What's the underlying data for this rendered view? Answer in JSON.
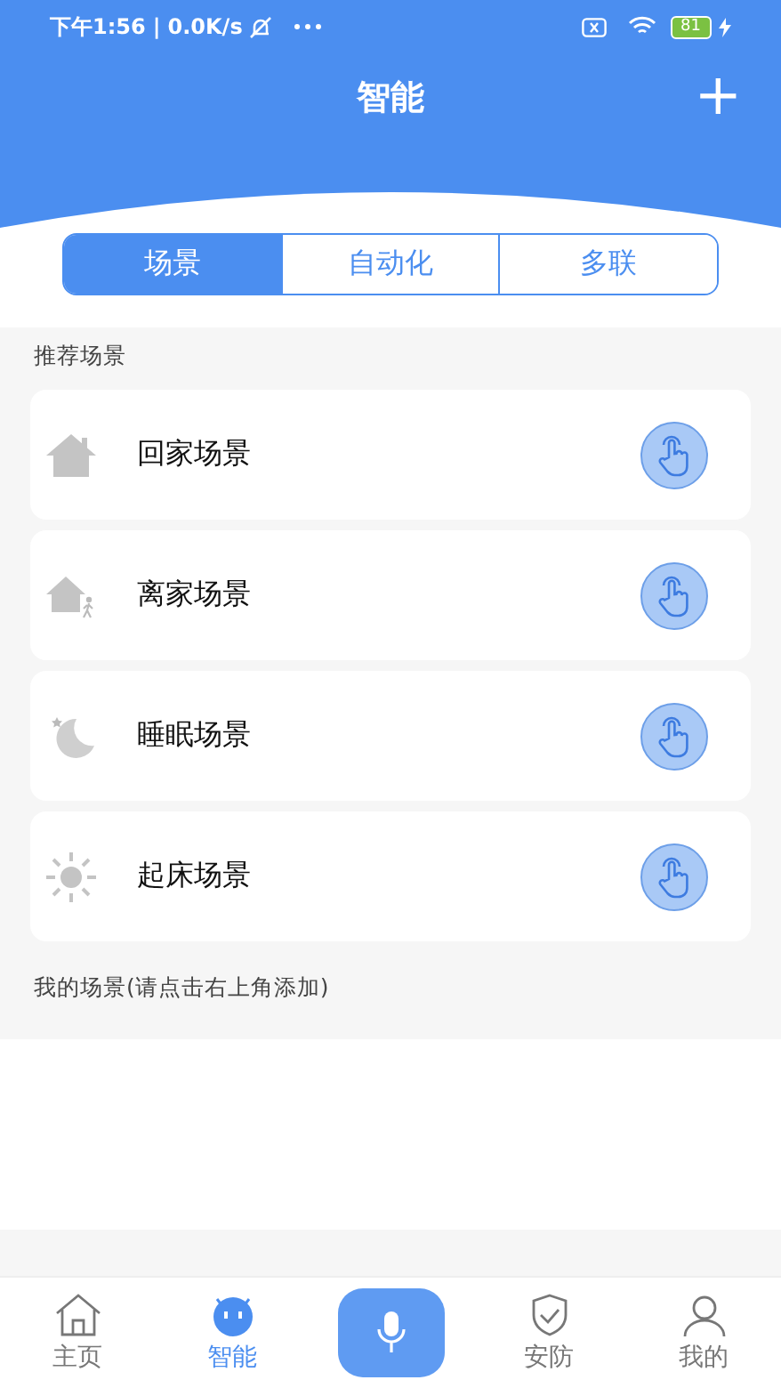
{
  "status_bar": {
    "time": "下午1:56",
    "separator": "|",
    "speed": "0.0K/s",
    "battery": "81"
  },
  "header": {
    "title": "智能",
    "add": "+"
  },
  "tabs": [
    {
      "label": "场景",
      "selected": true
    },
    {
      "label": "自动化",
      "selected": false
    },
    {
      "label": "多联",
      "selected": false
    }
  ],
  "recommended": {
    "title": "推荐场景",
    "scenes": [
      {
        "name": "回家场景",
        "kind": "home"
      },
      {
        "name": "离家场景",
        "kind": "leave"
      },
      {
        "name": "睡眠场景",
        "kind": "sleep"
      },
      {
        "name": "起床场景",
        "kind": "wake"
      }
    ]
  },
  "my_scenes": {
    "title": "我的场景(请点击右上角添加)"
  },
  "bottom_nav": [
    {
      "label": "主页",
      "kind": "home",
      "selected": false
    },
    {
      "label": "智能",
      "kind": "smart",
      "selected": true
    },
    {
      "kind": "mic",
      "selected": false
    },
    {
      "label": "安防",
      "kind": "shield",
      "selected": false
    },
    {
      "label": "我的",
      "kind": "user",
      "selected": false
    }
  ]
}
